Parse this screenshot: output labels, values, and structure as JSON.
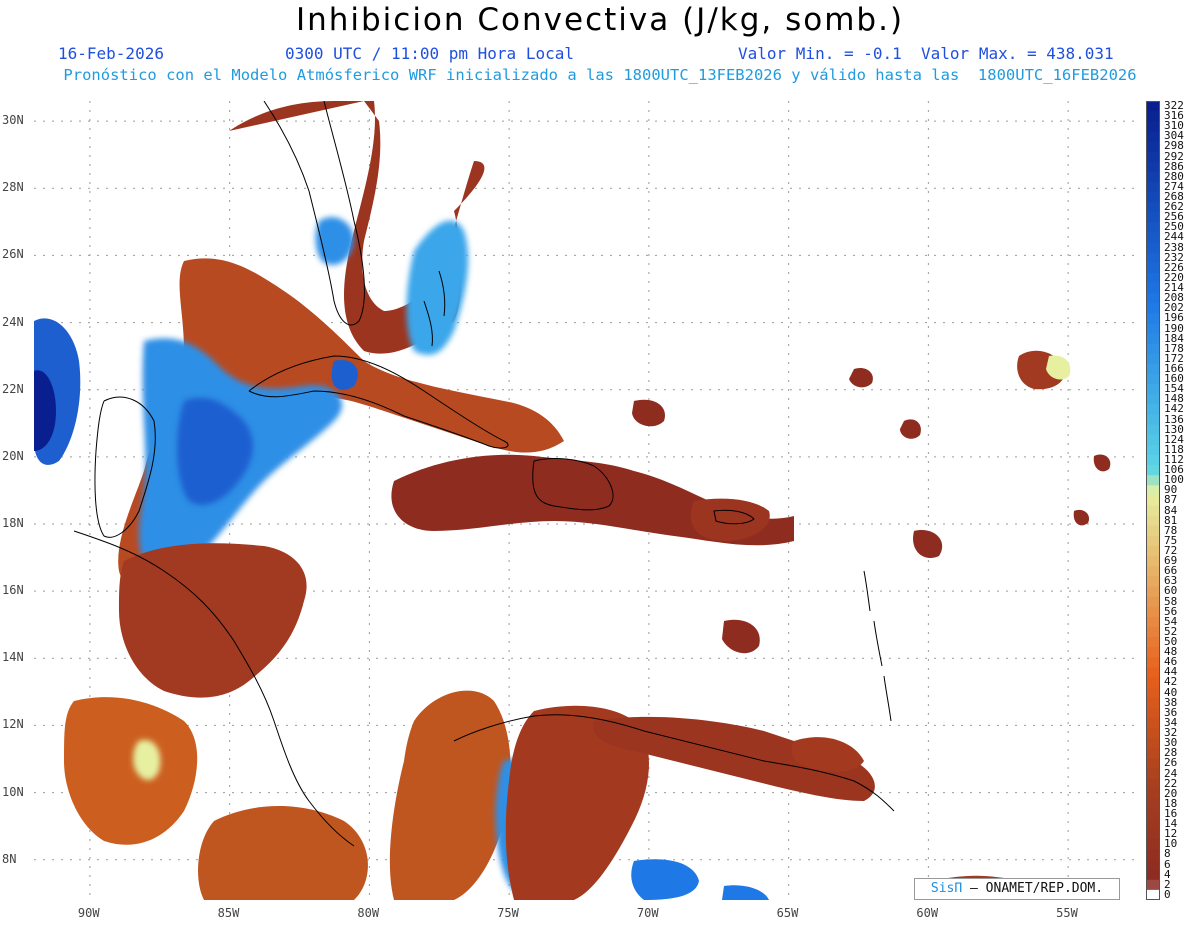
{
  "header": {
    "title": "Inhibicion Convectiva (J/kg, somb.)",
    "date": "16-Feb-2026",
    "time": "0300 UTC / 11:00 pm Hora Local",
    "value_range": "Valor Min. = -0.1  Valor Max. = 438.031",
    "subtitle": "Pronóstico con el Modelo Atmósferico WRF inicializado a las 1800UTC_13FEB2026 y válido hasta las  1800UTC_16FEB2026"
  },
  "map": {
    "lat_labels": [
      "30N",
      "28N",
      "26N",
      "24N",
      "22N",
      "20N",
      "18N",
      "16N",
      "14N",
      "12N",
      "10N",
      "8N"
    ],
    "lon_labels": [
      "90W",
      "85W",
      "80W",
      "75W",
      "70W",
      "65W",
      "60W",
      "55W"
    ],
    "lat_range": [
      6.8,
      30.6
    ],
    "lon_range": [
      -92.0,
      -52.5
    ]
  },
  "colorbar": {
    "labels": [
      "322",
      "316",
      "310",
      "304",
      "298",
      "292",
      "286",
      "280",
      "274",
      "268",
      "262",
      "256",
      "250",
      "244",
      "238",
      "232",
      "226",
      "220",
      "214",
      "208",
      "202",
      "196",
      "190",
      "184",
      "178",
      "172",
      "166",
      "160",
      "154",
      "148",
      "142",
      "136",
      "130",
      "124",
      "118",
      "112",
      "106",
      "100",
      "90",
      "87",
      "84",
      "81",
      "78",
      "75",
      "72",
      "69",
      "66",
      "63",
      "60",
      "58",
      "56",
      "54",
      "52",
      "50",
      "48",
      "46",
      "44",
      "42",
      "40",
      "38",
      "36",
      "34",
      "32",
      "30",
      "28",
      "26",
      "24",
      "22",
      "20",
      "18",
      "16",
      "14",
      "12",
      "10",
      "8",
      "6",
      "4",
      "2",
      "0"
    ],
    "colors": {
      "high": "#0a1f8f",
      "blue": "#1e78e6",
      "cyan": "#5bd6e6",
      "pale": "#e6f0a0",
      "orange": "#e8601c",
      "rust": "#a8401f",
      "dark": "#8a2a22",
      "zero": "#ffffff"
    }
  },
  "credit": {
    "brand": "SisΠ",
    "org": "– ONAMET/REP.DOM."
  }
}
